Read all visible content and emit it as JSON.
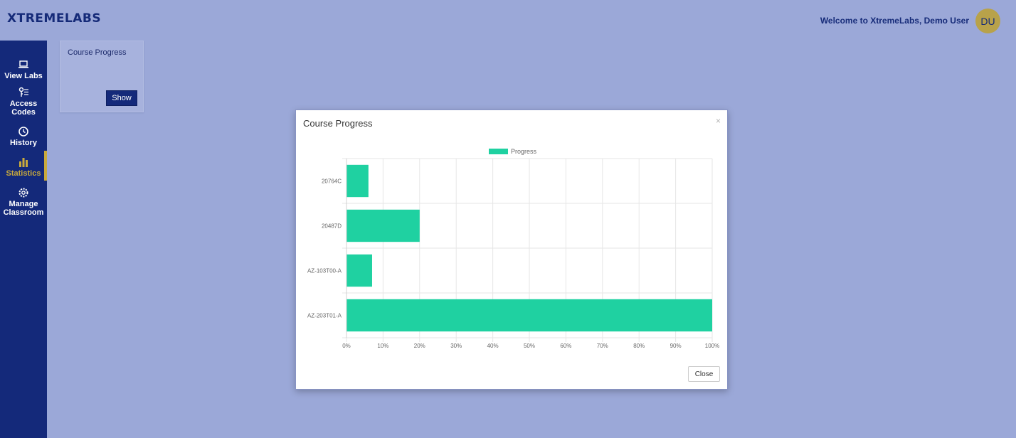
{
  "app": {
    "logo": "XTREMELABS",
    "welcome": "Welcome to XtremeLabs, Demo User",
    "avatar_initials": "DU"
  },
  "sidebar": {
    "items": [
      {
        "label": "View Labs",
        "icon": "laptop-icon",
        "active": false
      },
      {
        "label": "Access Codes",
        "icon": "access-codes-icon",
        "active": false
      },
      {
        "label": "History",
        "icon": "history-icon",
        "active": false
      },
      {
        "label": "Statistics",
        "icon": "bar-chart-icon",
        "active": true
      },
      {
        "label": "Manage Classroom",
        "icon": "gear-icon",
        "active": false
      }
    ]
  },
  "card": {
    "title": "Course Progress",
    "button": "Show"
  },
  "modal": {
    "title": "Course Progress",
    "close_x": "×",
    "close_button": "Close"
  },
  "colors": {
    "background": "#9ba8d8",
    "sidebar": "#14297a",
    "accent": "#c9aa3c",
    "bar": "#1fd1a1"
  },
  "chart_data": {
    "type": "bar",
    "orientation": "horizontal",
    "categories": [
      "20764C",
      "20487D",
      "AZ-103T00-A",
      "AZ-203T01-A"
    ],
    "series": [
      {
        "name": "Progress",
        "values": [
          6,
          20,
          7,
          100
        ]
      }
    ],
    "xlim": [
      0,
      100
    ],
    "x_ticks": [
      "0%",
      "10%",
      "20%",
      "30%",
      "40%",
      "50%",
      "60%",
      "70%",
      "80%",
      "90%",
      "100%"
    ],
    "grid": true,
    "legend": "top-center"
  }
}
